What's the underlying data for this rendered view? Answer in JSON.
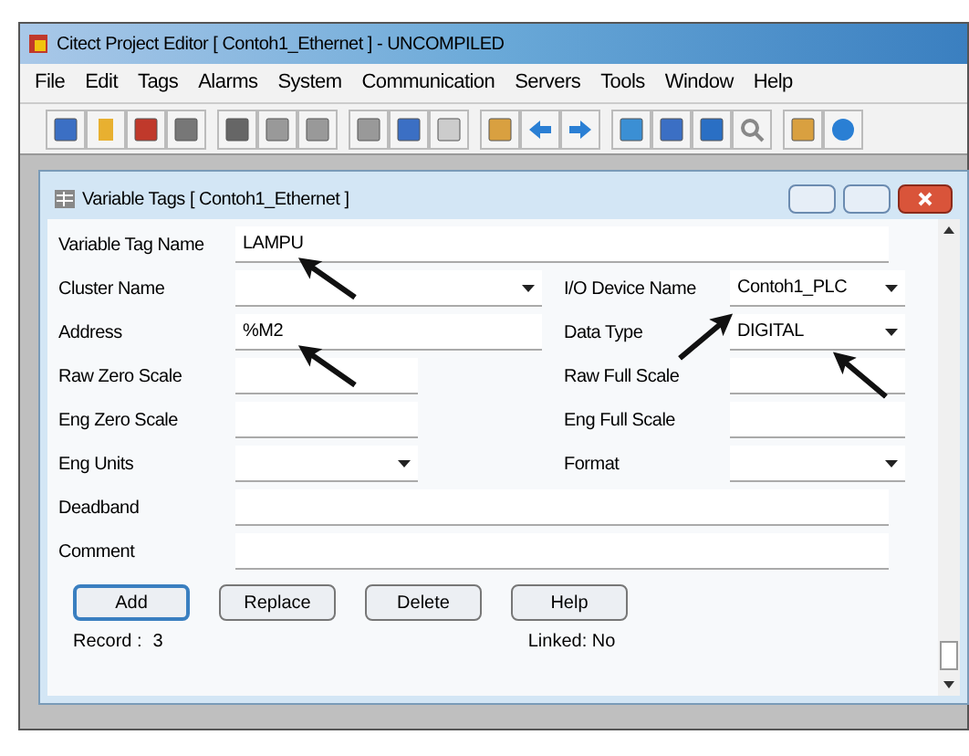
{
  "window": {
    "title": "Citect Project Editor [ Contoh1_Ethernet ] - UNCOMPILED"
  },
  "menu": [
    "File",
    "Edit",
    "Tags",
    "Alarms",
    "System",
    "Communication",
    "Servers",
    "Tools",
    "Window",
    "Help"
  ],
  "child_window": {
    "title": "Variable Tags [ Contoh1_Ethernet ]",
    "rows": [
      {
        "left": {
          "label": "Variable Tag Name",
          "value": "LAMPU",
          "kind": "text"
        }
      },
      {
        "left": {
          "label": "Cluster Name",
          "kind": "dropdown"
        },
        "right": {
          "label": "I/O Device Name",
          "value": "Contoh1_PLC",
          "kind": "dropdown"
        }
      },
      {
        "left": {
          "label": "Address",
          "value": "%M2",
          "kind": "text"
        },
        "right": {
          "label": "Data Type",
          "value": "DIGITAL",
          "kind": "dropdown"
        }
      },
      {
        "left": {
          "label": "Raw Zero Scale",
          "kind": "text"
        },
        "right": {
          "label": "Raw Full Scale",
          "kind": "text"
        }
      },
      {
        "left": {
          "label": "Eng Zero Scale",
          "kind": "text"
        },
        "right": {
          "label": "Eng Full Scale",
          "kind": "text"
        }
      },
      {
        "left": {
          "label": "Eng Units",
          "kind": "dropdown"
        },
        "right": {
          "label": "Format",
          "kind": "dropdown"
        }
      },
      {
        "left": {
          "label": "Deadband",
          "kind": "text"
        }
      },
      {
        "left": {
          "label": "Comment",
          "kind": "text"
        }
      }
    ],
    "buttons": [
      {
        "label": "Add",
        "selected": true
      },
      {
        "label": "Replace",
        "selected": false
      },
      {
        "label": "Delete",
        "selected": false
      },
      {
        "label": "Help",
        "selected": false
      }
    ],
    "record_label": "Record :",
    "record_value": "3",
    "linked": "Linked: No"
  }
}
